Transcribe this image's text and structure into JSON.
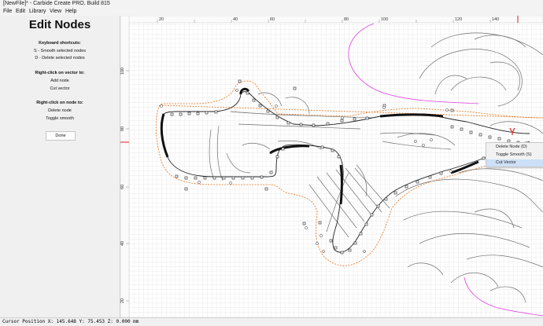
{
  "window": {
    "title": "[NewFile]* - Carbide Create PRO, Build 815"
  },
  "menu": [
    "File",
    "Edit",
    "Library",
    "View",
    "Help"
  ],
  "panel": {
    "heading": "Edit Nodes",
    "keyboard_heading": "Keyboard shortcuts:",
    "shortcut_smooth": "S - Smooth selected nodes",
    "shortcut_delete": "D - Delete selected nodes",
    "vector_heading": "Right-click on vector to:",
    "vector_add": "Add node",
    "vector_cut": "Cut vector",
    "node_heading": "Right-click on node to:",
    "node_delete": "Delete node",
    "node_toggle": "Toggle smooth",
    "done_label": "Done"
  },
  "ruler": {
    "x_ticks": [
      "20",
      "40",
      "60",
      "80",
      "100",
      "120",
      "140"
    ],
    "y_ticks": [
      "100",
      "80",
      "60",
      "40",
      "20"
    ]
  },
  "context_menu": {
    "items": [
      "Delete Node (D)",
      "Toggle Smooth (S)",
      "Cut Vector"
    ],
    "highlighted": "Cut Vector"
  },
  "status": {
    "cursor": "Cursor Position X: 145.648 Y: 75.453 Z: 0.000 mm"
  },
  "colors": {
    "offset_orange": "#e8771f",
    "magenta": "#e040e0",
    "red_marker": "#e02020",
    "highlight": "#cde0f7"
  }
}
